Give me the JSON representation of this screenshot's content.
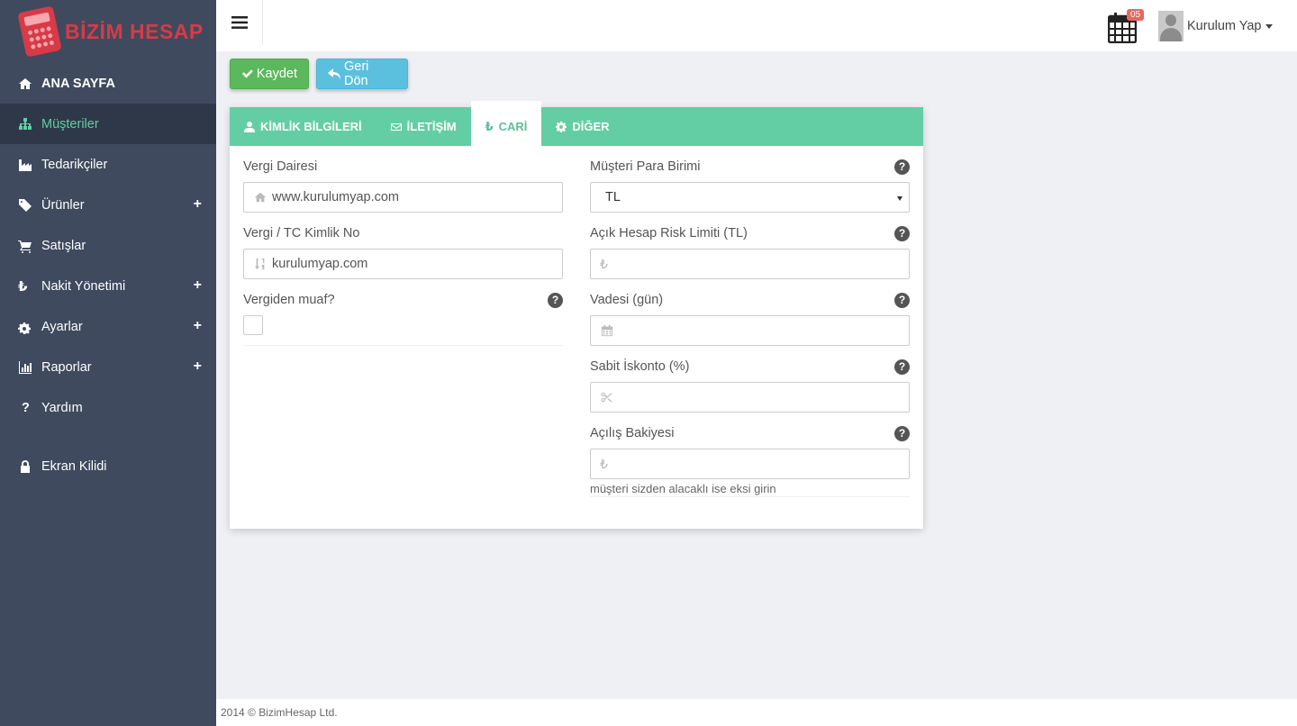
{
  "brand": {
    "name": "BİZİM HESAP"
  },
  "sidebar": {
    "items": [
      {
        "label": "ANA SAYFA",
        "icon": "home-icon"
      },
      {
        "label": "Müşteriler",
        "icon": "sitemap-icon"
      },
      {
        "label": "Tedarikçiler",
        "icon": "industry-icon"
      },
      {
        "label": "Ürünler",
        "icon": "tags-icon",
        "expand": "+"
      },
      {
        "label": "Satışlar",
        "icon": "cart-icon"
      },
      {
        "label": "Nakit Yönetimi",
        "icon": "lira-icon",
        "expand": "+"
      },
      {
        "label": "Ayarlar",
        "icon": "cogs-icon",
        "expand": "+"
      },
      {
        "label": "Raporlar",
        "icon": "bar-chart-icon",
        "expand": "+"
      },
      {
        "label": "Yardım",
        "icon": "question-icon"
      },
      {
        "label": "Ekran Kilidi",
        "icon": "lock-icon"
      }
    ],
    "active_index": 1
  },
  "header": {
    "notification_count": "05",
    "user_name": "Kurulum Yap"
  },
  "toolbar": {
    "save_label": "Kaydet",
    "back_label": "Geri Dön"
  },
  "tabs": [
    {
      "label": "KİMLİK BİLGİLERİ",
      "icon": "user-icon"
    },
    {
      "label": "İLETİŞİM",
      "icon": "envelope-icon"
    },
    {
      "label": "CARİ",
      "icon": "lira-icon"
    },
    {
      "label": "DİĞER",
      "icon": "gear-icon"
    }
  ],
  "form": {
    "tax_office": {
      "label": "Vergi Dairesi",
      "value": "www.kurulumyap.com"
    },
    "tax_id": {
      "label": "Vergi / TC Kimlik No",
      "value": "kurulumyap.com"
    },
    "tax_exempt": {
      "label": "Vergiden muaf?",
      "help": "?"
    },
    "currency": {
      "label": "Müşteri Para Birimi",
      "value": "TL",
      "help": "?"
    },
    "risk_limit": {
      "label": "Açık Hesap Risk Limiti (TL)",
      "prefix": "₺",
      "help": "?"
    },
    "due_days": {
      "label": "Vadesi (gün)",
      "help": "?"
    },
    "discount": {
      "label": "Sabit İskonto (%)",
      "help": "?"
    },
    "opening_balance": {
      "label": "Açılış Bakiyesi",
      "prefix": "₺",
      "help": "?",
      "hint": "müşteri sizden alacaklı ise eksi girin"
    }
  },
  "footer": {
    "text": "2014 © BizimHesap Ltd."
  },
  "colors": {
    "sidebar": "#3f4a5e",
    "accent": "#63cea3",
    "brand": "#d83a47",
    "save": "#5cb85c",
    "back": "#5bc0de"
  }
}
